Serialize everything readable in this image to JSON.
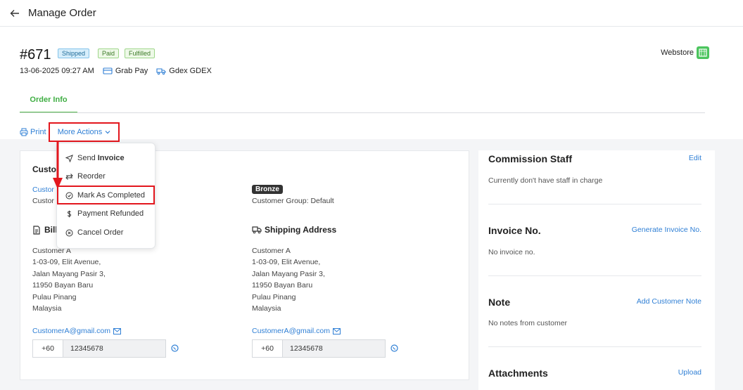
{
  "topbar": {
    "title": "Manage Order"
  },
  "order": {
    "number": "#671",
    "badges": [
      "Shipped",
      "Paid",
      "Fulfilled"
    ],
    "datetime": "13-06-2025 09:27 AM",
    "payment": "Grab Pay",
    "courier": "Gdex GDEX",
    "channel": "Webstore"
  },
  "tabs": [
    {
      "label": "Order Info"
    }
  ],
  "actions": {
    "print": "Print",
    "more": "More Actions"
  },
  "dropdown": {
    "send_prefix": "Send",
    "send_bold": "Invoice",
    "items": [
      "Reorder",
      "Mark As Completed",
      "Payment Refunded",
      "Cancel Order"
    ]
  },
  "customer": {
    "heading_partial": "Custo",
    "name_partial": "Custor",
    "sub_partial": "Custor",
    "tier": "Bronze",
    "group": "Customer Group: Default"
  },
  "billing": {
    "heading_partial": "Bill",
    "lines": [
      "Customer A",
      "1-03-09, Elit Avenue,",
      "Jalan Mayang Pasir 3,",
      "11950 Bayan Baru",
      "Pulau Pinang",
      "Malaysia"
    ],
    "email": "CustomerA@gmail.com",
    "country_code": "+60",
    "phone": "12345678"
  },
  "shipping": {
    "heading": "Shipping Address",
    "lines": [
      "Customer A",
      "1-03-09, Elit Avenue,",
      "Jalan Mayang Pasir 3,",
      "11950 Bayan Baru",
      "Pulau Pinang",
      "Malaysia"
    ],
    "email": "CustomerA@gmail.com",
    "country_code": "+60",
    "phone": "12345678"
  },
  "side": {
    "commission": {
      "title": "Commission Staff",
      "action": "Edit",
      "text": "Currently don't have staff in charge"
    },
    "invoice": {
      "title": "Invoice No.",
      "action": "Generate Invoice No.",
      "text": "No invoice no."
    },
    "note": {
      "title": "Note",
      "action": "Add Customer Note",
      "text": "No notes from customer"
    },
    "attachments": {
      "title": "Attachments",
      "action": "Upload"
    }
  },
  "colors": {
    "accent": "#2f7fd5",
    "tab": "#3fae43",
    "highlight": "#e3161d"
  }
}
